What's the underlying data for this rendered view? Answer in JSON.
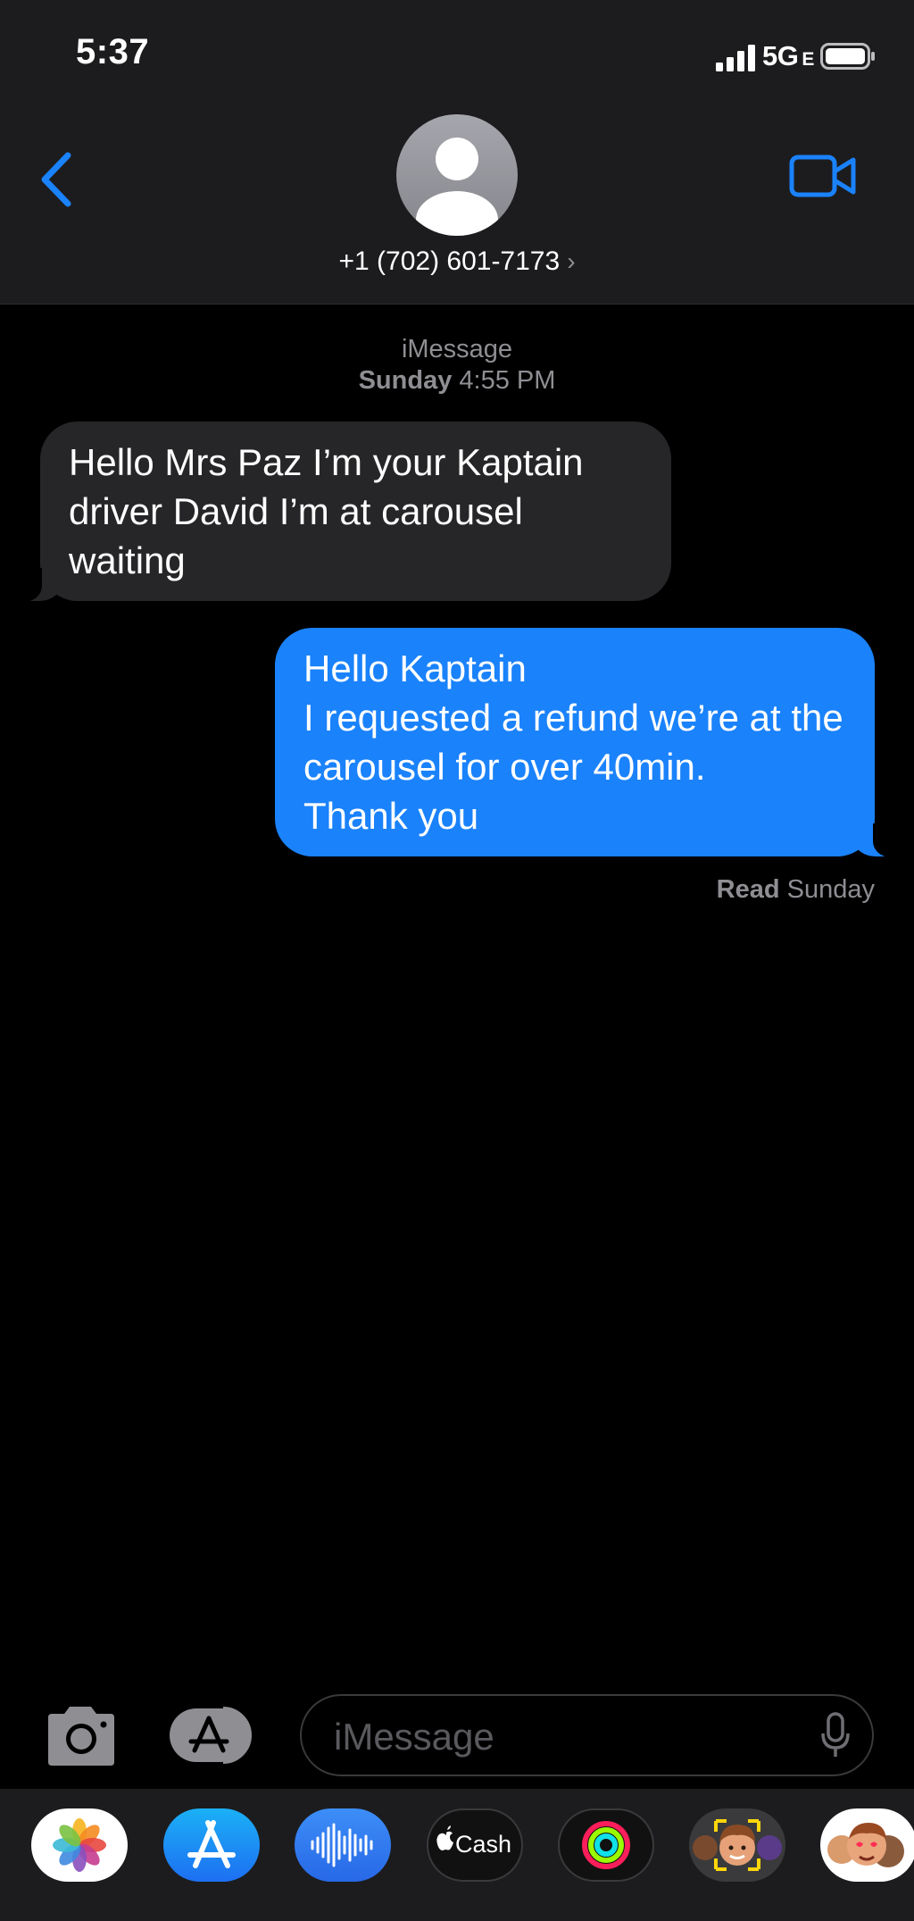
{
  "status_bar": {
    "time": "5:37",
    "network": "5G",
    "network_suffix": "E"
  },
  "header": {
    "contact": "+1 (702) 601-7173",
    "chevron": "›"
  },
  "thread": {
    "service": "iMessage",
    "timestamp_day": "Sunday",
    "timestamp_time": "4:55 PM",
    "messages": [
      {
        "direction": "incoming",
        "text": "Hello Mrs Paz I’m your Kaptain driver David I’m at carousel waiting"
      },
      {
        "direction": "outgoing",
        "text": "Hello Kaptain\nI requested a refund we’re at the carousel for over 40min.\nThank you"
      }
    ],
    "receipt_status": "Read",
    "receipt_time": "Sunday"
  },
  "composer": {
    "placeholder": "iMessage"
  },
  "app_tray": {
    "items": [
      {
        "name": "photos",
        "icon": "photos-icon"
      },
      {
        "name": "app-store",
        "icon": "app-store-icon"
      },
      {
        "name": "audio-message",
        "icon": "waveform-icon"
      },
      {
        "name": "apple-cash",
        "icon": "apple-cash-icon",
        "label": "Cash"
      },
      {
        "name": "activity",
        "icon": "activity-rings-icon"
      },
      {
        "name": "memoji",
        "icon": "memoji-icon"
      },
      {
        "name": "memoji-stickers",
        "icon": "memoji-stickers-icon"
      }
    ]
  },
  "colors": {
    "accent": "#1a82fb",
    "incoming_bubble": "#262628",
    "bar_background": "#1c1c1e",
    "secondary_text": "#8e8e93"
  }
}
